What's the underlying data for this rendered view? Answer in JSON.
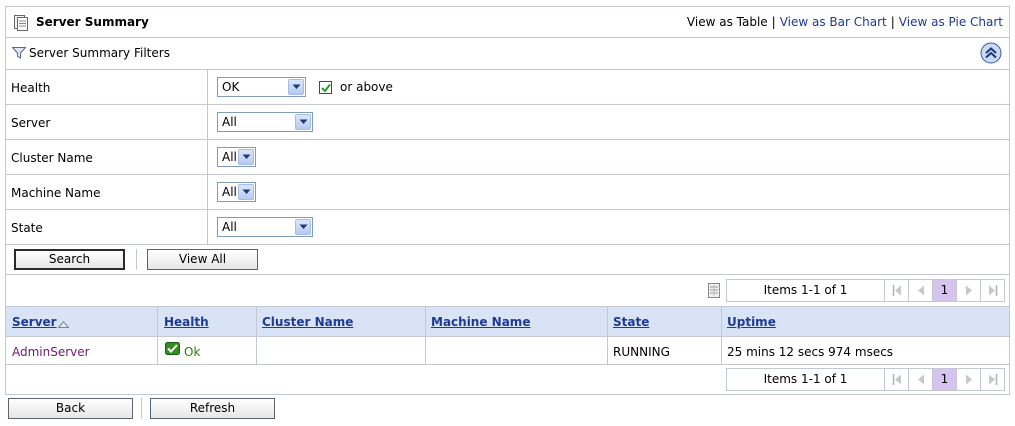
{
  "header": {
    "title": "Server Summary",
    "icon": "document-icon",
    "view_links": {
      "table": "View as Table",
      "separator": "|",
      "bar_chart": "View as Bar Chart",
      "pie_chart": "View as Pie Chart"
    }
  },
  "filters": {
    "title": "Server Summary Filters",
    "rows": [
      {
        "label": "Health",
        "value": "OK",
        "extra_checkbox_label": "or above",
        "checked": true
      },
      {
        "label": "Server",
        "value": "All"
      },
      {
        "label": "Cluster Name",
        "value": "All"
      },
      {
        "label": "Machine Name",
        "value": "All"
      },
      {
        "label": "State",
        "value": "All"
      }
    ],
    "search_button": "Search",
    "view_all_button": "View All"
  },
  "pager": {
    "items_label": "Items 1-1 of 1",
    "current_page": "1"
  },
  "table": {
    "columns": [
      "Server",
      "Health",
      "Cluster Name",
      "Machine Name",
      "State",
      "Uptime"
    ],
    "rows": [
      {
        "server": "AdminServer",
        "health": "Ok",
        "cluster": "",
        "machine": "",
        "state": "RUNNING",
        "uptime": "25 mins 12 secs 974 msecs"
      }
    ]
  },
  "footer": {
    "back_button": "Back",
    "refresh_button": "Refresh"
  },
  "colors": {
    "link": "#1f3a93",
    "header_bg": "#d8e3f6",
    "ok_green": "#2e7d0c",
    "page_highlight": "#d6c4ef"
  }
}
